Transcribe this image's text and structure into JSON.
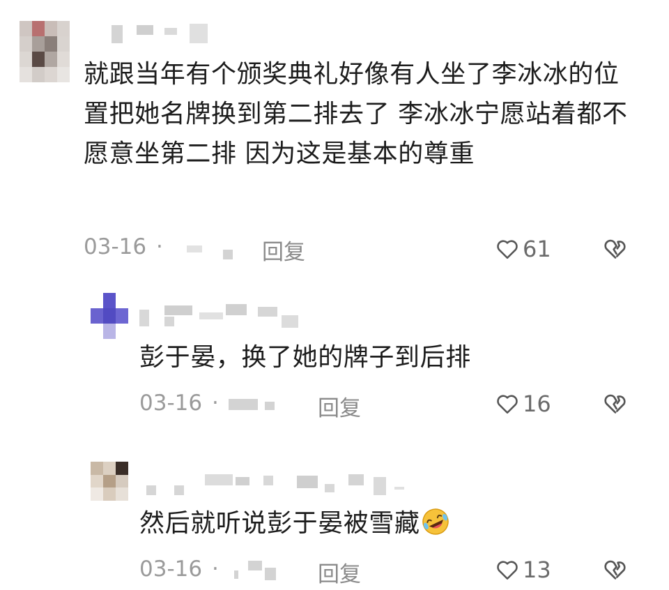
{
  "comments": [
    {
      "text": "就跟当年有个颁奖典礼好像有人坐了李冰冰的位置把她名牌换到第二排去了 李冰冰宁愿站着都不愿意坐第二排 因为这是基本的尊重",
      "date": "03-16",
      "reply_label": "回复",
      "likes": "61"
    },
    {
      "text": "彭于晏，换了她的牌子到后排",
      "date": "03-16",
      "reply_label": "回复",
      "likes": "16"
    },
    {
      "text": "然后就听说彭于晏被雪藏",
      "emoji": "rolling-on-floor-laughing",
      "date": "03-16",
      "reply_label": "回复",
      "likes": "13"
    }
  ],
  "colors": {
    "text": "#1c1c1c",
    "meta": "#9a9a9a",
    "icon": "#555555",
    "avatar2_accent": "#5b54c9"
  }
}
